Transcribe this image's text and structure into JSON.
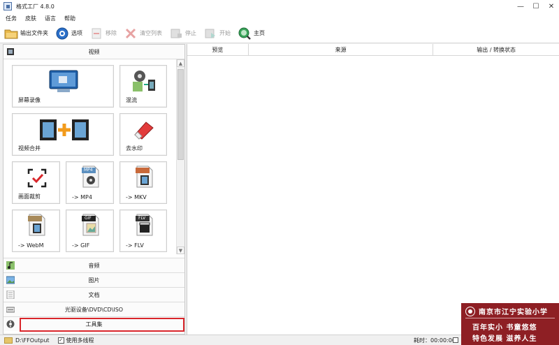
{
  "window": {
    "title": "格式工厂 4.8.0",
    "controls": [
      "—",
      "☐",
      "✕"
    ]
  },
  "menu": [
    "任务",
    "皮肤",
    "语言",
    "帮助"
  ],
  "toolbar": {
    "output_folder": "输出文件夹",
    "options": "选项",
    "remove": "移除",
    "clear_list": "清空列表",
    "stop": "停止",
    "start": "开始",
    "home": "主页"
  },
  "left_panel": {
    "video_category": "视频",
    "tiles": {
      "screen_record": "屏幕录像",
      "mix": "混流",
      "video_merge": "视频合并",
      "remove_watermark": "去水印",
      "crop": "画面裁剪",
      "mp4": "-> MP4",
      "mkv": "-> MKV",
      "webm": "-> WebM",
      "gif": "-> GIF",
      "flv": "-> FLV"
    },
    "badges": {
      "mp4": "MP4",
      "gif": "GIF",
      "flv": "FLV"
    },
    "categories": {
      "audio": "音频",
      "image": "图片",
      "document": "文档",
      "optical": "光驱设备\\DVD\\CD\\ISO",
      "toolbox": "工具集"
    }
  },
  "table": {
    "columns": [
      "预览",
      "来源",
      "输出 / 转换状态"
    ]
  },
  "status": {
    "output_path": "D:\\FFOutput",
    "multithread_label": "使用多线程",
    "multithread_checked": "✓",
    "elapsed_label": "耗时：00:00:00"
  },
  "watermark": {
    "school": "南京市江宁实验小学",
    "line1": "百年实小  书童悠悠",
    "line2": "特色发展  滋养人生"
  },
  "colors": {
    "highlight_border": "#d9262b",
    "watermark_bg": "#8e1f24"
  }
}
